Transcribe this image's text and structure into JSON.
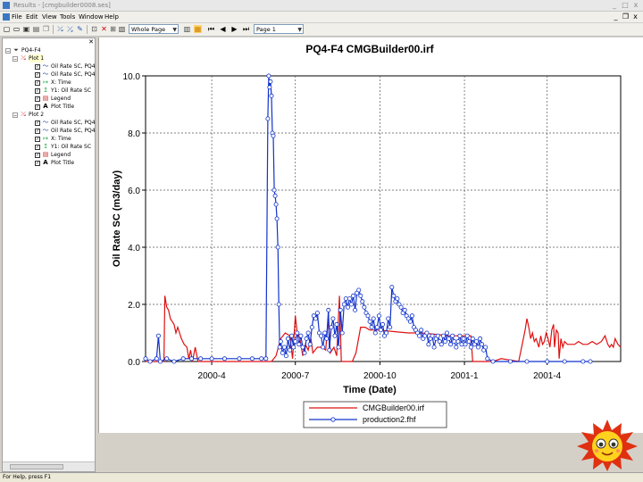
{
  "window": {
    "title": "Results - [cmgbuilder0008.ses]",
    "controls": [
      "_",
      "□",
      "x"
    ]
  },
  "menu": {
    "items": [
      "File",
      "Edit",
      "View",
      "Tools",
      "Window",
      "Help"
    ],
    "mdi_controls": [
      "_",
      "❐",
      "x"
    ]
  },
  "toolbar": {
    "view_combo": "Whole Page",
    "page_combo": "Page 1"
  },
  "tree": {
    "root": "PQ4-F4",
    "plots": [
      {
        "label": "Plot 1",
        "children": [
          "Oil Rate SC, PQ4",
          "Oil Rate SC, PQ4",
          "X:  Time",
          "Y1: Oil Rate SC",
          "Legend",
          "Plot Title"
        ]
      },
      {
        "label": "Plot 2",
        "children": [
          "Oil Rate SC, PQ4",
          "Oil Rate SC, PQ4",
          "X:  Time",
          "Y1: Oil Rate SC",
          "Legend",
          "Plot Title"
        ]
      }
    ]
  },
  "chart_data": {
    "type": "line",
    "title": "PQ4-F4 CMGBuilder00.irf",
    "xlabel": "Time (Date)",
    "ylabel": "Oil Rate SC (m3/day)",
    "ylim": [
      0,
      10
    ],
    "xlim": [
      "2000-01-20",
      "2001-06-20"
    ],
    "yticks": [
      "0.0",
      "2.0",
      "4.0",
      "6.0",
      "8.0",
      "10.0"
    ],
    "xticks": [
      {
        "date": "2000-04-01",
        "label": "2000-4"
      },
      {
        "date": "2000-07-01",
        "label": "2000-7"
      },
      {
        "date": "2000-10-01",
        "label": "2000-10"
      },
      {
        "date": "2001-01-01",
        "label": "2001-1"
      },
      {
        "date": "2001-04-01",
        "label": "2001-4"
      }
    ],
    "grid": true,
    "legend_position": "bottom",
    "series": [
      {
        "name": "CMGBuilder00.irf",
        "color": "#dd1111",
        "marker": "none",
        "points": [
          [
            "2000-01-20",
            0.0
          ],
          [
            "2000-02-01",
            0.0
          ],
          [
            "2000-02-09",
            0.0
          ],
          [
            "2000-02-10",
            2.3
          ],
          [
            "2000-02-12",
            1.9
          ],
          [
            "2000-02-14",
            1.8
          ],
          [
            "2000-02-16",
            1.5
          ],
          [
            "2000-02-18",
            1.4
          ],
          [
            "2000-02-20",
            1.3
          ],
          [
            "2000-02-22",
            1.0
          ],
          [
            "2000-02-24",
            1.2
          ],
          [
            "2000-02-26",
            1.0
          ],
          [
            "2000-02-28",
            0.8
          ],
          [
            "2000-03-02",
            0.6
          ],
          [
            "2000-03-05",
            0.5
          ],
          [
            "2000-03-07",
            0.1
          ],
          [
            "2000-03-09",
            0.4
          ],
          [
            "2000-03-11",
            0.0
          ],
          [
            "2000-03-14",
            0.5
          ],
          [
            "2000-03-17",
            0.0
          ],
          [
            "2000-03-20",
            0.0
          ],
          [
            "2000-06-01",
            0.0
          ],
          [
            "2000-06-05",
            0.0
          ],
          [
            "2000-06-10",
            0.2
          ],
          [
            "2000-06-15",
            0.8
          ],
          [
            "2000-06-20",
            1.0
          ],
          [
            "2000-06-25",
            0.9
          ],
          [
            "2000-06-28",
            0.1
          ],
          [
            "2000-07-01",
            1.6
          ],
          [
            "2000-07-03",
            1.0
          ],
          [
            "2000-07-06",
            0.8
          ],
          [
            "2000-07-09",
            0.2
          ],
          [
            "2000-07-12",
            0.6
          ],
          [
            "2000-07-15",
            0.4
          ],
          [
            "2000-07-18",
            0.8
          ],
          [
            "2000-07-20",
            0.3
          ],
          [
            "2000-07-25",
            0.5
          ],
          [
            "2000-07-30",
            0.5
          ],
          [
            "2000-08-03",
            0.4
          ],
          [
            "2000-08-06",
            1.6
          ],
          [
            "2000-08-08",
            0.3
          ],
          [
            "2000-08-12",
            0.5
          ],
          [
            "2000-08-15",
            0.2
          ],
          [
            "2000-08-18",
            2.3
          ],
          [
            "2000-08-20",
            0.0
          ],
          [
            "2000-08-25",
            0.0
          ],
          [
            "2000-09-01",
            0.0
          ],
          [
            "2000-09-05",
            0.3
          ],
          [
            "2000-09-10",
            1.2
          ],
          [
            "2000-09-15",
            1.2
          ],
          [
            "2000-09-20",
            1.1
          ],
          [
            "2000-09-25",
            1.1
          ],
          [
            "2000-10-01",
            1.1
          ],
          [
            "2000-10-15",
            1.05
          ],
          [
            "2000-11-01",
            1.0
          ],
          [
            "2000-11-15",
            1.0
          ],
          [
            "2000-12-01",
            0.95
          ],
          [
            "2000-12-15",
            0.9
          ],
          [
            "2001-01-01",
            0.9
          ],
          [
            "2001-01-08",
            0.9
          ],
          [
            "2001-01-10",
            0.0
          ],
          [
            "2001-01-20",
            0.0
          ],
          [
            "2001-02-01",
            0.0
          ],
          [
            "2001-02-10",
            0.1
          ],
          [
            "2001-03-01",
            0.0
          ],
          [
            "2001-03-08",
            1.1
          ],
          [
            "2001-03-10",
            1.5
          ],
          [
            "2001-03-12",
            1.2
          ],
          [
            "2001-03-14",
            0.8
          ],
          [
            "2001-03-16",
            1.0
          ],
          [
            "2001-03-18",
            0.7
          ],
          [
            "2001-03-20",
            0.8
          ],
          [
            "2001-03-23",
            0.5
          ],
          [
            "2001-03-25",
            0.9
          ],
          [
            "2001-03-27",
            0.6
          ],
          [
            "2001-03-29",
            0.7
          ],
          [
            "2001-03-31",
            1.0
          ],
          [
            "2001-04-02",
            0.8
          ],
          [
            "2001-04-04",
            0.5
          ],
          [
            "2001-04-06",
            1.1
          ],
          [
            "2001-04-08",
            1.3
          ],
          [
            "2001-04-09",
            0.5
          ],
          [
            "2001-04-11",
            1.1
          ],
          [
            "2001-04-13",
            1.0
          ],
          [
            "2001-04-14",
            0.1
          ],
          [
            "2001-04-16",
            0.8
          ],
          [
            "2001-04-18",
            0.5
          ],
          [
            "2001-04-20",
            0.7
          ],
          [
            "2001-04-23",
            0.6
          ],
          [
            "2001-04-26",
            0.6
          ],
          [
            "2001-05-01",
            0.6
          ],
          [
            "2001-05-05",
            0.7
          ],
          [
            "2001-05-10",
            0.6
          ],
          [
            "2001-05-15",
            0.6
          ],
          [
            "2001-05-20",
            0.7
          ],
          [
            "2001-05-25",
            0.6
          ],
          [
            "2001-05-30",
            0.7
          ],
          [
            "2001-06-03",
            0.9
          ],
          [
            "2001-06-06",
            0.6
          ],
          [
            "2001-06-08",
            0.5
          ],
          [
            "2001-06-10",
            0.6
          ],
          [
            "2001-06-12",
            0.5
          ],
          [
            "2001-06-14",
            0.8
          ],
          [
            "2001-06-17",
            0.6
          ],
          [
            "2001-06-20",
            0.5
          ]
        ]
      },
      {
        "name": "production2.fhf",
        "color": "#1133cc",
        "marker": "circle",
        "points": [
          [
            "2000-01-20",
            0.1
          ],
          [
            "2000-01-25",
            0.0
          ],
          [
            "2000-02-01",
            0.1
          ],
          [
            "2000-02-03",
            0.9
          ],
          [
            "2000-02-05",
            0.0
          ],
          [
            "2000-02-12",
            0.1
          ],
          [
            "2000-02-20",
            0.0
          ],
          [
            "2000-03-01",
            0.1
          ],
          [
            "2000-03-10",
            0.1
          ],
          [
            "2000-03-20",
            0.1
          ],
          [
            "2000-04-01",
            0.1
          ],
          [
            "2000-04-15",
            0.1
          ],
          [
            "2000-05-01",
            0.1
          ],
          [
            "2000-05-15",
            0.1
          ],
          [
            "2000-05-25",
            0.1
          ],
          [
            "2000-05-30",
            0.1
          ],
          [
            "2000-06-01",
            8.5
          ],
          [
            "2000-06-02",
            10.0
          ],
          [
            "2000-06-03",
            9.6
          ],
          [
            "2000-06-04",
            9.8
          ],
          [
            "2000-06-05",
            9.3
          ],
          [
            "2000-06-06",
            8.0
          ],
          [
            "2000-06-07",
            7.9
          ],
          [
            "2000-06-08",
            6.0
          ],
          [
            "2000-06-09",
            5.8
          ],
          [
            "2000-06-10",
            5.5
          ],
          [
            "2000-06-11",
            5.0
          ],
          [
            "2000-06-12",
            4.0
          ],
          [
            "2000-06-13",
            2.0
          ],
          [
            "2000-06-14",
            0.5
          ],
          [
            "2000-06-15",
            0.7
          ],
          [
            "2000-06-17",
            0.3
          ],
          [
            "2000-06-19",
            0.5
          ],
          [
            "2000-06-21",
            0.2
          ],
          [
            "2000-06-23",
            0.8
          ],
          [
            "2000-06-25",
            0.4
          ],
          [
            "2000-06-27",
            0.9
          ],
          [
            "2000-06-29",
            0.5
          ],
          [
            "2000-07-01",
            0.7
          ],
          [
            "2000-07-03",
            1.0
          ],
          [
            "2000-07-05",
            0.6
          ],
          [
            "2000-07-07",
            0.9
          ],
          [
            "2000-07-09",
            0.5
          ],
          [
            "2000-07-11",
            0.3
          ],
          [
            "2000-07-13",
            0.8
          ],
          [
            "2000-07-15",
            1.0
          ],
          [
            "2000-07-17",
            0.6
          ],
          [
            "2000-07-19",
            1.2
          ],
          [
            "2000-07-21",
            1.6
          ],
          [
            "2000-07-23",
            1.5
          ],
          [
            "2000-07-25",
            1.7
          ],
          [
            "2000-07-27",
            1.0
          ],
          [
            "2000-07-29",
            0.9
          ],
          [
            "2000-07-31",
            0.5
          ],
          [
            "2000-08-02",
            1.0
          ],
          [
            "2000-08-04",
            0.8
          ],
          [
            "2000-08-06",
            1.8
          ],
          [
            "2000-08-07",
            0.4
          ],
          [
            "2000-08-09",
            1.2
          ],
          [
            "2000-08-11",
            1.5
          ],
          [
            "2000-08-13",
            0.9
          ],
          [
            "2000-08-15",
            1.3
          ],
          [
            "2000-08-17",
            0.5
          ],
          [
            "2000-08-19",
            1.8
          ],
          [
            "2000-08-21",
            1.0
          ],
          [
            "2000-08-23",
            2.0
          ],
          [
            "2000-08-25",
            2.2
          ],
          [
            "2000-08-27",
            1.9
          ],
          [
            "2000-08-29",
            2.2
          ],
          [
            "2000-08-31",
            2.0
          ],
          [
            "2000-09-02",
            2.3
          ],
          [
            "2000-09-04",
            1.8
          ],
          [
            "2000-09-06",
            2.4
          ],
          [
            "2000-09-08",
            2.5
          ],
          [
            "2000-09-10",
            2.3
          ],
          [
            "2000-09-12",
            2.1
          ],
          [
            "2000-09-14",
            1.9
          ],
          [
            "2000-09-16",
            1.7
          ],
          [
            "2000-09-18",
            1.6
          ],
          [
            "2000-09-20",
            1.4
          ],
          [
            "2000-09-22",
            1.2
          ],
          [
            "2000-09-24",
            1.5
          ],
          [
            "2000-09-26",
            1.0
          ],
          [
            "2000-09-28",
            1.2
          ],
          [
            "2000-09-30",
            1.6
          ],
          [
            "2000-10-02",
            1.1
          ],
          [
            "2000-10-04",
            1.3
          ],
          [
            "2000-10-06",
            0.9
          ],
          [
            "2000-10-08",
            1.0
          ],
          [
            "2000-10-10",
            1.5
          ],
          [
            "2000-10-12",
            1.2
          ],
          [
            "2000-10-14",
            2.6
          ],
          [
            "2000-10-16",
            2.3
          ],
          [
            "2000-10-18",
            2.1
          ],
          [
            "2000-10-20",
            2.2
          ],
          [
            "2000-10-22",
            2.0
          ],
          [
            "2000-10-24",
            1.9
          ],
          [
            "2000-10-26",
            1.7
          ],
          [
            "2000-10-28",
            1.8
          ],
          [
            "2000-10-30",
            1.6
          ],
          [
            "2000-11-01",
            1.5
          ],
          [
            "2000-11-03",
            1.4
          ],
          [
            "2000-11-05",
            1.6
          ],
          [
            "2000-11-07",
            1.2
          ],
          [
            "2000-11-09",
            1.1
          ],
          [
            "2000-11-11",
            1.0
          ],
          [
            "2000-11-13",
            0.9
          ],
          [
            "2000-11-15",
            1.1
          ],
          [
            "2000-11-17",
            0.8
          ],
          [
            "2000-11-19",
            0.9
          ],
          [
            "2000-11-21",
            1.0
          ],
          [
            "2000-11-23",
            0.6
          ],
          [
            "2000-11-25",
            0.8
          ],
          [
            "2000-11-27",
            0.9
          ],
          [
            "2000-11-29",
            0.5
          ],
          [
            "2000-12-01",
            0.8
          ],
          [
            "2000-12-03",
            0.9
          ],
          [
            "2000-12-05",
            0.7
          ],
          [
            "2000-12-07",
            0.6
          ],
          [
            "2000-12-09",
            0.9
          ],
          [
            "2000-12-11",
            0.7
          ],
          [
            "2000-12-13",
            1.0
          ],
          [
            "2000-12-15",
            0.8
          ],
          [
            "2000-12-17",
            0.6
          ],
          [
            "2000-12-19",
            0.9
          ],
          [
            "2000-12-21",
            0.7
          ],
          [
            "2000-12-23",
            0.5
          ],
          [
            "2000-12-25",
            0.7
          ],
          [
            "2000-12-27",
            0.9
          ],
          [
            "2000-12-29",
            0.6
          ],
          [
            "2000-12-31",
            0.8
          ],
          [
            "2001-01-02",
            0.6
          ],
          [
            "2001-01-04",
            0.9
          ],
          [
            "2001-01-06",
            0.7
          ],
          [
            "2001-01-08",
            0.5
          ],
          [
            "2001-01-10",
            0.8
          ],
          [
            "2001-01-12",
            0.6
          ],
          [
            "2001-01-14",
            0.7
          ],
          [
            "2001-01-16",
            0.5
          ],
          [
            "2001-01-18",
            0.8
          ],
          [
            "2001-01-20",
            0.6
          ],
          [
            "2001-01-22",
            0.4
          ],
          [
            "2001-01-24",
            0.5
          ],
          [
            "2001-01-26",
            0.1
          ],
          [
            "2001-02-01",
            0.0
          ],
          [
            "2001-02-20",
            0.0
          ],
          [
            "2001-03-10",
            0.0
          ],
          [
            "2001-04-01",
            0.0
          ],
          [
            "2001-04-20",
            0.0
          ],
          [
            "2001-05-10",
            0.0
          ],
          [
            "2001-05-18",
            0.0
          ]
        ]
      }
    ]
  }
}
